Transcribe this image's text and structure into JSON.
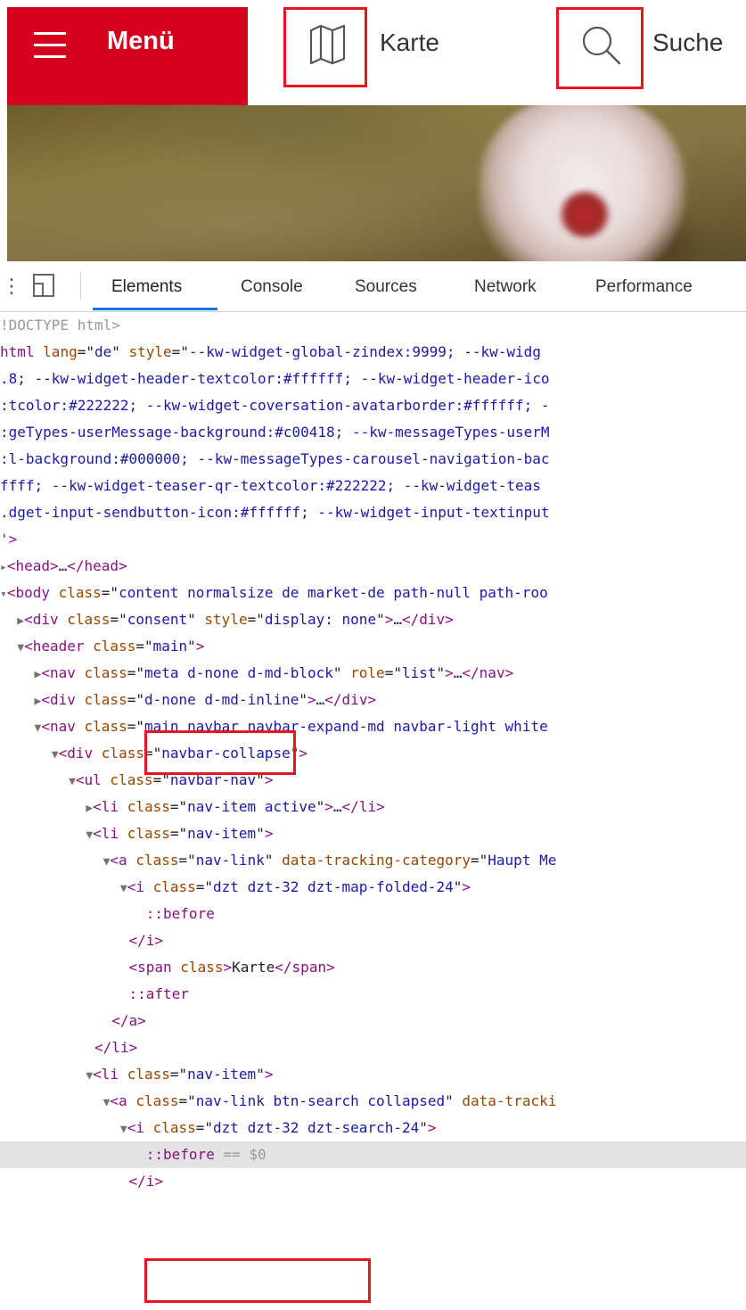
{
  "header": {
    "menu_label": "Menü",
    "karte_label": "Karte",
    "suche_label": "Suche",
    "brand_color": "#d4021e",
    "highlight_color": "#e81420"
  },
  "devtools": {
    "tabs": [
      "Elements",
      "Console",
      "Sources",
      "Network",
      "Performance"
    ],
    "active_tab": "Elements",
    "lines": [
      {
        "ind": "",
        "tri": "",
        "html": [
          [
            "gray",
            "!DOCTYPE html>"
          ]
        ]
      },
      {
        "ind": "",
        "tri": "",
        "html": [
          [
            "tag",
            "html "
          ],
          [
            "attr",
            "lang"
          ],
          [
            "txt",
            "=\""
          ],
          [
            "val",
            "de"
          ],
          [
            "txt",
            "\" "
          ],
          [
            "attr",
            "style"
          ],
          [
            "txt",
            "=\""
          ],
          [
            "val",
            "--kw-widget-global-zindex:9999; --kw-widg"
          ]
        ]
      },
      {
        "ind": "",
        "tri": "",
        "html": [
          [
            "val",
            ".8; --kw-widget-header-textcolor:#ffffff; --kw-widget-header-ico"
          ]
        ]
      },
      {
        "ind": "",
        "tri": "",
        "html": [
          [
            "val",
            ":tcolor:#222222; --kw-widget-coversation-avatarborder:#ffffff; -"
          ]
        ]
      },
      {
        "ind": "",
        "tri": "",
        "html": [
          [
            "val",
            ":geTypes-userMessage-background:#c00418; --kw-messageTypes-userM"
          ]
        ]
      },
      {
        "ind": "",
        "tri": "",
        "html": [
          [
            "val",
            ":l-background:#000000; --kw-messageTypes-carousel-navigation-bac"
          ]
        ]
      },
      {
        "ind": "",
        "tri": "",
        "html": [
          [
            "val",
            "ffff; --kw-widget-teaser-qr-textcolor:#222222; --kw-widget-teas"
          ]
        ]
      },
      {
        "ind": "",
        "tri": "",
        "html": [
          [
            "val",
            ".dget-input-sendbutton-icon:#ffffff; --kw-widget-input-textinput"
          ]
        ]
      },
      {
        "ind": "",
        "tri": "",
        "html": [
          [
            "tag",
            "'>"
          ]
        ]
      },
      {
        "ind": "",
        "tri": "▸",
        "html": [
          [
            "tag",
            "<head>"
          ],
          [
            "txt",
            "…"
          ],
          [
            "tag",
            "</head>"
          ]
        ]
      },
      {
        "ind": "",
        "tri": "▾",
        "html": [
          [
            "tag",
            "<body "
          ],
          [
            "attr",
            "class"
          ],
          [
            "txt",
            "=\""
          ],
          [
            "val",
            "content normalsize de market-de path-null path-roo"
          ]
        ]
      },
      {
        "ind": "  ",
        "tri": "▶",
        "html": [
          [
            "tag",
            "<div "
          ],
          [
            "attr",
            "class"
          ],
          [
            "txt",
            "=\""
          ],
          [
            "val",
            "consent"
          ],
          [
            "txt",
            "\" "
          ],
          [
            "attr",
            "style"
          ],
          [
            "txt",
            "=\""
          ],
          [
            "val",
            "display: none"
          ],
          [
            "txt",
            "\""
          ],
          [
            "tag",
            ">"
          ],
          [
            "txt",
            "…"
          ],
          [
            "tag",
            "</div>"
          ]
        ]
      },
      {
        "ind": "  ",
        "tri": "▼",
        "html": [
          [
            "tag",
            "<header "
          ],
          [
            "attr",
            "class"
          ],
          [
            "txt",
            "=\""
          ],
          [
            "val",
            "main"
          ],
          [
            "txt",
            "\""
          ],
          [
            "tag",
            ">"
          ]
        ]
      },
      {
        "ind": "    ",
        "tri": "▶",
        "html": [
          [
            "tag",
            "<nav "
          ],
          [
            "attr",
            "class"
          ],
          [
            "txt",
            "=\""
          ],
          [
            "val",
            "meta d-none d-md-block"
          ],
          [
            "txt",
            "\" "
          ],
          [
            "attr",
            "role"
          ],
          [
            "txt",
            "=\""
          ],
          [
            "val",
            "list"
          ],
          [
            "txt",
            "\""
          ],
          [
            "tag",
            ">"
          ],
          [
            "txt",
            "…"
          ],
          [
            "tag",
            "</nav>"
          ]
        ]
      },
      {
        "ind": "    ",
        "tri": "▶",
        "html": [
          [
            "tag",
            "<div "
          ],
          [
            "attr",
            "class"
          ],
          [
            "txt",
            "=\""
          ],
          [
            "val",
            "d-none d-md-inline"
          ],
          [
            "txt",
            "\""
          ],
          [
            "tag",
            ">"
          ],
          [
            "txt",
            "…"
          ],
          [
            "tag",
            "</div>"
          ]
        ]
      },
      {
        "ind": "    ",
        "tri": "▼",
        "html": [
          [
            "tag",
            "<nav "
          ],
          [
            "attr",
            "class"
          ],
          [
            "txt",
            "=\""
          ],
          [
            "val",
            "main navbar navbar-expand-md navbar-light white"
          ]
        ]
      },
      {
        "ind": "      ",
        "tri": "▼",
        "html": [
          [
            "tag",
            "<div "
          ],
          [
            "attr",
            "class"
          ],
          [
            "txt",
            "=\""
          ],
          [
            "val",
            "navbar-collapse"
          ],
          [
            "txt",
            "\""
          ],
          [
            "tag",
            ">"
          ]
        ]
      },
      {
        "ind": "        ",
        "tri": "▼",
        "html": [
          [
            "tag",
            "<ul "
          ],
          [
            "attr",
            "class"
          ],
          [
            "txt",
            "=\""
          ],
          [
            "val",
            "navbar-nav"
          ],
          [
            "txt",
            "\""
          ],
          [
            "tag",
            ">"
          ]
        ]
      },
      {
        "ind": "          ",
        "tri": "▶",
        "html": [
          [
            "tag",
            "<li "
          ],
          [
            "attr",
            "class"
          ],
          [
            "txt",
            "=\""
          ],
          [
            "val",
            "nav-item active"
          ],
          [
            "txt",
            "\""
          ],
          [
            "tag",
            ">"
          ],
          [
            "txt",
            "…"
          ],
          [
            "tag",
            "</li>"
          ]
        ]
      },
      {
        "ind": "          ",
        "tri": "▼",
        "html": [
          [
            "tag",
            "<li "
          ],
          [
            "attr",
            "class"
          ],
          [
            "txt",
            "=\""
          ],
          [
            "val",
            "nav-item"
          ],
          [
            "txt",
            "\""
          ],
          [
            "tag",
            ">"
          ]
        ]
      },
      {
        "ind": "            ",
        "tri": "▼",
        "html": [
          [
            "tag",
            "<a "
          ],
          [
            "attr",
            "class"
          ],
          [
            "txt",
            "=\""
          ],
          [
            "val",
            "nav-link"
          ],
          [
            "txt",
            "\" "
          ],
          [
            "attr",
            "data-tracking-category"
          ],
          [
            "txt",
            "=\""
          ],
          [
            "val",
            "Haupt Me"
          ]
        ]
      },
      {
        "ind": "              ",
        "tri": "▼",
        "html": [
          [
            "tag",
            "<i "
          ],
          [
            "attr",
            "class"
          ],
          [
            "txt",
            "=\""
          ],
          [
            "val",
            "dzt dzt-32 dzt-map-folded-24"
          ],
          [
            "txt",
            "\""
          ],
          [
            "tag",
            ">"
          ]
        ]
      },
      {
        "ind": "                 ",
        "tri": "",
        "html": [
          [
            "tag",
            "::before"
          ]
        ]
      },
      {
        "ind": "               ",
        "tri": "",
        "html": [
          [
            "tag",
            "</i>"
          ]
        ]
      },
      {
        "ind": "               ",
        "tri": "",
        "html": [
          [
            "tag",
            "<span "
          ],
          [
            "attr",
            "class"
          ],
          [
            "tag",
            ">"
          ],
          [
            "txt",
            "Karte"
          ],
          [
            "tag",
            "</span>"
          ]
        ]
      },
      {
        "ind": "               ",
        "tri": "",
        "html": [
          [
            "tag",
            "::after"
          ]
        ]
      },
      {
        "ind": "             ",
        "tri": "",
        "html": [
          [
            "tag",
            "</a>"
          ]
        ]
      },
      {
        "ind": "           ",
        "tri": "",
        "html": [
          [
            "tag",
            "</li>"
          ]
        ]
      },
      {
        "ind": "          ",
        "tri": "▼",
        "html": [
          [
            "tag",
            "<li "
          ],
          [
            "attr",
            "class"
          ],
          [
            "txt",
            "=\""
          ],
          [
            "val",
            "nav-item"
          ],
          [
            "txt",
            "\""
          ],
          [
            "tag",
            ">"
          ]
        ]
      },
      {
        "ind": "            ",
        "tri": "▼",
        "html": [
          [
            "tag",
            "<a "
          ],
          [
            "attr",
            "class"
          ],
          [
            "txt",
            "=\""
          ],
          [
            "val",
            "nav-link btn-search collapsed"
          ],
          [
            "txt",
            "\" "
          ],
          [
            "attr",
            "data-tracki"
          ]
        ]
      },
      {
        "ind": "              ",
        "tri": "▼",
        "html": [
          [
            "tag",
            "<i "
          ],
          [
            "attr",
            "class"
          ],
          [
            "txt",
            "=\""
          ],
          [
            "val",
            "dzt dzt-32 dzt-search-24"
          ],
          [
            "txt",
            "\""
          ],
          [
            "tag",
            ">"
          ]
        ]
      },
      {
        "ind": "                 ",
        "tri": "",
        "html": [
          [
            "tag",
            "::before"
          ],
          [
            "gray",
            " == $0"
          ]
        ]
      },
      {
        "ind": "               ",
        "tri": "",
        "html": [
          [
            "tag",
            "</i>"
          ]
        ]
      }
    ],
    "selected_line": 31
  }
}
